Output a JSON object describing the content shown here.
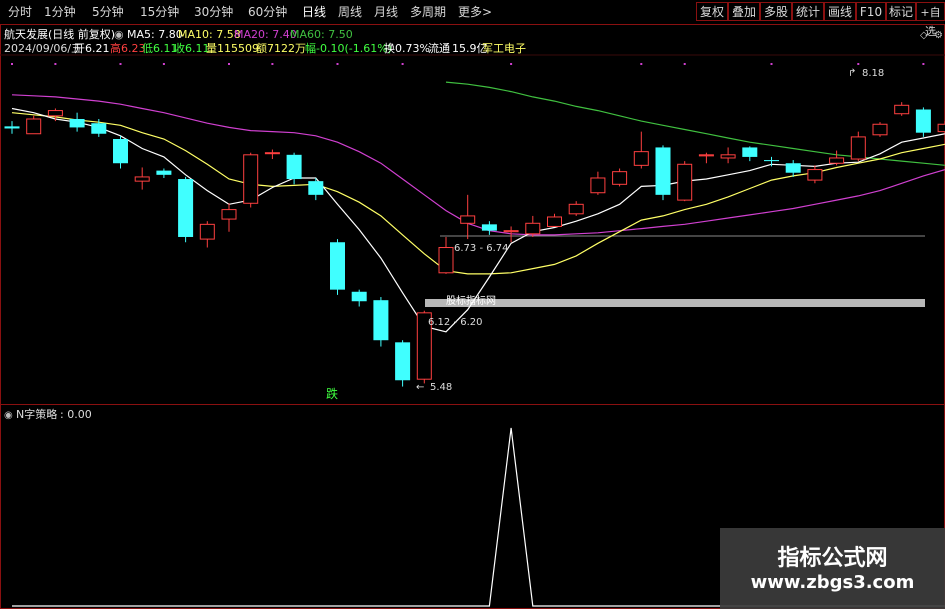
{
  "tabs": [
    "分时",
    "1分钟",
    "5分钟",
    "15分钟",
    "30分钟",
    "60分钟",
    "日线",
    "周线",
    "月线",
    "多周期",
    "更多>"
  ],
  "active_tab": "日线",
  "right_buttons": [
    "复权",
    "叠加",
    "多股",
    "统计",
    "画线",
    "F10",
    "标记",
    "+自选"
  ],
  "stock_title": "航天发展(日线 前复权)",
  "ma_labels": [
    {
      "label": "MA5: 7.80",
      "color": "#ffffff"
    },
    {
      "label": "MA10: 7.58",
      "color": "#ffff66"
    },
    {
      "label": "MA20: 7.40",
      "color": "#d040d0"
    },
    {
      "label": "MA60: 7.50",
      "color": "#40c040"
    }
  ],
  "info_line": {
    "date": "2024/09/06/五",
    "open_label": "开",
    "open": "6.21",
    "high_label": "高",
    "high": "6.23",
    "low_label": "低",
    "low": "6.11",
    "close_label": "收",
    "close": "6.11",
    "volume_label": "量",
    "volume": "115509",
    "amount_label": "额",
    "amount": "7122万",
    "change_label": "幅",
    "change": "-0.10(-1.61%)",
    "turnover_label": "换",
    "turnover": "0.73%",
    "float_label": "流通",
    "float": "15.9亿",
    "sector": "军工电子"
  },
  "annotations": {
    "high_price": "8.18",
    "low_price": "5.48",
    "range1": "6.73 - 6.74",
    "range2": "6.12 - 6.20",
    "watermark_bar": "股标指标网",
    "signal_char": "跌"
  },
  "indicator": {
    "name": "N字策略",
    "value": ": 0.00"
  },
  "watermark": {
    "title": "指标公式网",
    "url": "www.zbgs3.com"
  },
  "colors": {
    "up": "#ff4040",
    "down": "#40ffff",
    "ma5": "#ffffff",
    "ma10": "#ffff66",
    "ma20": "#d040d0",
    "ma60": "#40c040",
    "border": "#8a1010"
  },
  "chart_data": {
    "type": "candlestick",
    "candles": [
      {
        "o": 7.95,
        "h": 8.0,
        "l": 7.88,
        "c": 7.93
      },
      {
        "o": 7.88,
        "h": 8.05,
        "l": 7.88,
        "c": 8.02
      },
      {
        "o": 8.05,
        "h": 8.12,
        "l": 8.0,
        "c": 8.1
      },
      {
        "o": 8.02,
        "h": 8.08,
        "l": 7.9,
        "c": 7.94
      },
      {
        "o": 7.98,
        "h": 8.02,
        "l": 7.85,
        "c": 7.88
      },
      {
        "o": 7.83,
        "h": 7.86,
        "l": 7.55,
        "c": 7.6
      },
      {
        "o": 7.43,
        "h": 7.56,
        "l": 7.35,
        "c": 7.47
      },
      {
        "o": 7.53,
        "h": 7.55,
        "l": 7.46,
        "c": 7.49
      },
      {
        "o": 7.45,
        "h": 7.47,
        "l": 6.85,
        "c": 6.9
      },
      {
        "o": 6.88,
        "h": 7.05,
        "l": 6.8,
        "c": 7.02
      },
      {
        "o": 7.07,
        "h": 7.22,
        "l": 6.95,
        "c": 7.16
      },
      {
        "o": 7.22,
        "h": 7.7,
        "l": 7.18,
        "c": 7.68
      },
      {
        "o": 7.7,
        "h": 7.73,
        "l": 7.64,
        "c": 7.7
      },
      {
        "o": 7.68,
        "h": 7.7,
        "l": 7.4,
        "c": 7.45
      },
      {
        "o": 7.43,
        "h": 7.46,
        "l": 7.25,
        "c": 7.3
      },
      {
        "o": 6.85,
        "h": 6.88,
        "l": 6.35,
        "c": 6.4
      },
      {
        "o": 6.38,
        "h": 6.4,
        "l": 6.24,
        "c": 6.29
      },
      {
        "o": 6.3,
        "h": 6.33,
        "l": 5.86,
        "c": 5.92
      },
      {
        "o": 5.9,
        "h": 5.92,
        "l": 5.48,
        "c": 5.54
      },
      {
        "o": 5.55,
        "h": 6.2,
        "l": 5.51,
        "c": 6.18
      },
      {
        "o": 6.56,
        "h": 6.9,
        "l": 6.55,
        "c": 6.8
      },
      {
        "o": 7.03,
        "h": 7.3,
        "l": 6.88,
        "c": 7.1
      },
      {
        "o": 7.02,
        "h": 7.05,
        "l": 6.92,
        "c": 6.96
      },
      {
        "o": 6.95,
        "h": 7.0,
        "l": 6.85,
        "c": 6.96
      },
      {
        "o": 6.93,
        "h": 7.1,
        "l": 6.9,
        "c": 7.03
      },
      {
        "o": 7.0,
        "h": 7.12,
        "l": 7.0,
        "c": 7.09
      },
      {
        "o": 7.12,
        "h": 7.24,
        "l": 7.1,
        "c": 7.21
      },
      {
        "o": 7.32,
        "h": 7.52,
        "l": 7.3,
        "c": 7.46
      },
      {
        "o": 7.4,
        "h": 7.55,
        "l": 7.38,
        "c": 7.52
      },
      {
        "o": 7.58,
        "h": 7.9,
        "l": 7.55,
        "c": 7.71
      },
      {
        "o": 7.75,
        "h": 7.77,
        "l": 7.25,
        "c": 7.3
      },
      {
        "o": 7.25,
        "h": 7.62,
        "l": 7.24,
        "c": 7.59
      },
      {
        "o": 7.67,
        "h": 7.7,
        "l": 7.6,
        "c": 7.68
      },
      {
        "o": 7.65,
        "h": 7.75,
        "l": 7.6,
        "c": 7.68
      },
      {
        "o": 7.75,
        "h": 7.76,
        "l": 7.62,
        "c": 7.66
      },
      {
        "o": 7.63,
        "h": 7.66,
        "l": 7.57,
        "c": 7.62
      },
      {
        "o": 7.6,
        "h": 7.63,
        "l": 7.47,
        "c": 7.51
      },
      {
        "o": 7.44,
        "h": 7.58,
        "l": 7.41,
        "c": 7.54
      },
      {
        "o": 7.6,
        "h": 7.72,
        "l": 7.58,
        "c": 7.65
      },
      {
        "o": 7.64,
        "h": 7.9,
        "l": 7.62,
        "c": 7.85
      },
      {
        "o": 7.87,
        "h": 7.99,
        "l": 7.85,
        "c": 7.97
      },
      {
        "o": 8.07,
        "h": 8.18,
        "l": 8.05,
        "c": 8.15
      },
      {
        "o": 8.11,
        "h": 8.13,
        "l": 7.85,
        "c": 7.89
      },
      {
        "o": 7.9,
        "h": 8.0,
        "l": 7.88,
        "c": 7.97
      },
      {
        "o": 8.0,
        "h": 8.13,
        "l": 7.96,
        "c": 8.1
      }
    ],
    "ma5": [
      8.12,
      8.08,
      8.02,
      7.99,
      7.94,
      7.86,
      7.74,
      7.66,
      7.49,
      7.34,
      7.21,
      7.25,
      7.37,
      7.46,
      7.46,
      7.21,
      6.97,
      6.7,
      6.37,
      6.05,
      6.0,
      6.21,
      6.52,
      6.84,
      6.95,
      6.99,
      7.05,
      7.12,
      7.21,
      7.38,
      7.39,
      7.43,
      7.45,
      7.49,
      7.53,
      7.59,
      7.58,
      7.57,
      7.6,
      7.61,
      7.69,
      7.8,
      7.84,
      7.88,
      7.96
    ],
    "ma10": [
      8.08,
      8.06,
      8.04,
      8.01,
      7.99,
      7.96,
      7.89,
      7.83,
      7.72,
      7.59,
      7.45,
      7.4,
      7.38,
      7.39,
      7.4,
      7.33,
      7.23,
      7.1,
      6.92,
      6.74,
      6.58,
      6.55,
      6.55,
      6.56,
      6.6,
      6.64,
      6.72,
      6.84,
      6.95,
      7.06,
      7.1,
      7.16,
      7.21,
      7.28,
      7.36,
      7.44,
      7.48,
      7.51,
      7.56,
      7.6,
      7.64,
      7.7,
      7.74,
      7.78,
      7.82
    ],
    "ma20": [
      8.25,
      8.24,
      8.23,
      8.21,
      8.19,
      8.16,
      8.12,
      8.08,
      8.03,
      7.98,
      7.94,
      7.91,
      7.9,
      7.89,
      7.86,
      7.8,
      7.71,
      7.6,
      7.45,
      7.3,
      7.15,
      7.03,
      6.96,
      6.93,
      6.92,
      6.92,
      6.93,
      6.94,
      6.96,
      6.98,
      7.0,
      7.02,
      7.05,
      7.08,
      7.11,
      7.14,
      7.17,
      7.21,
      7.25,
      7.29,
      7.34,
      7.41,
      7.48,
      7.54,
      7.6
    ],
    "ma60": [
      null,
      null,
      null,
      null,
      null,
      null,
      null,
      null,
      null,
      null,
      null,
      null,
      null,
      null,
      null,
      null,
      null,
      null,
      null,
      null,
      8.37,
      8.35,
      8.32,
      8.28,
      8.23,
      8.19,
      8.14,
      8.1,
      8.05,
      8.0,
      7.96,
      7.92,
      7.88,
      7.84,
      7.8,
      7.77,
      7.74,
      7.71,
      7.68,
      7.66,
      7.64,
      7.62,
      7.6,
      7.58,
      7.57
    ],
    "ylim": [
      5.4,
      8.58
    ],
    "indicator_values": [
      0,
      0,
      0,
      0,
      0,
      0,
      0,
      0,
      0,
      0,
      0,
      0,
      0,
      0,
      0,
      0,
      0,
      0,
      0,
      0,
      0,
      0,
      0,
      1,
      0,
      0,
      0,
      0,
      0,
      0,
      0,
      0,
      0,
      0,
      0,
      0,
      0,
      0,
      0,
      0,
      0,
      0,
      0,
      0,
      0
    ]
  }
}
